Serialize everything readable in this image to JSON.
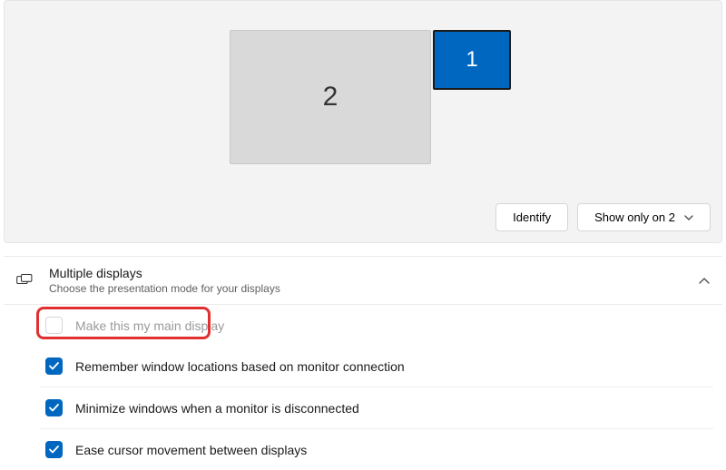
{
  "displays": {
    "monitor1_label": "1",
    "monitor2_label": "2"
  },
  "buttons": {
    "identify": "Identify",
    "projection_mode": "Show only on 2"
  },
  "section": {
    "title": "Multiple displays",
    "subtitle": "Choose the presentation mode for your displays"
  },
  "options": {
    "main_display": {
      "label": "Make this my main display",
      "checked": false,
      "enabled": false
    },
    "remember_locations": {
      "label": "Remember window locations based on monitor connection",
      "checked": true,
      "enabled": true
    },
    "minimize_on_disconnect": {
      "label": "Minimize windows when a monitor is disconnected",
      "checked": true,
      "enabled": true
    },
    "ease_cursor": {
      "label": "Ease cursor movement between displays",
      "checked": true,
      "enabled": true
    }
  }
}
